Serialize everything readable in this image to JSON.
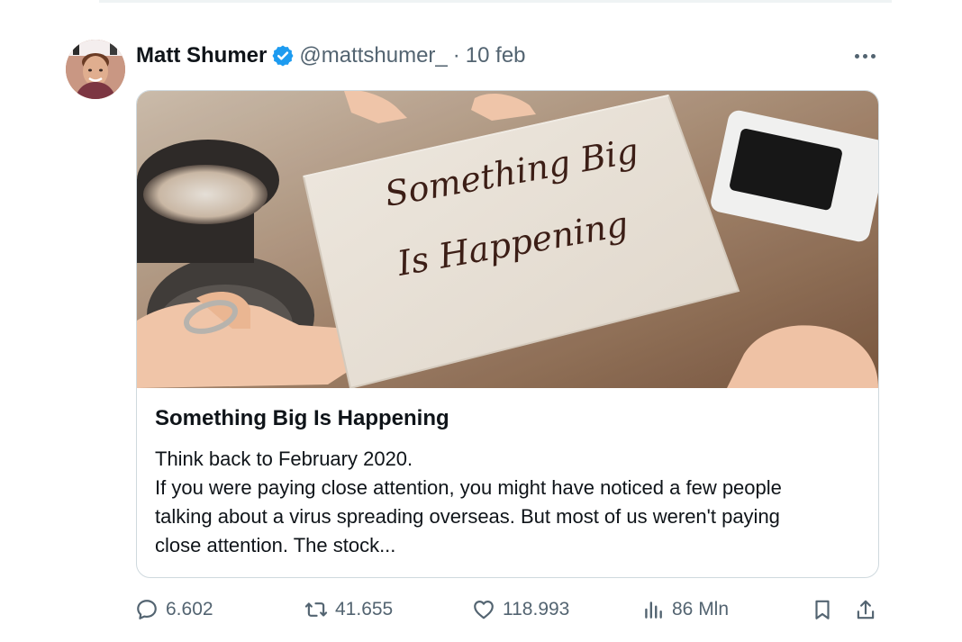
{
  "post": {
    "author_name": "Matt Shumer",
    "handle": "@mattshumer_",
    "separator": "·",
    "date": "10 feb",
    "card": {
      "image_text": [
        "Something Big",
        "Is Happening"
      ],
      "title": "Something Big Is Happening",
      "body_lines": [
        "Think back to February 2020.",
        "If you were paying close attention, you might have noticed a few people",
        "talking about a virus spreading overseas. But most of us weren't paying",
        "close attention. The stock..."
      ]
    },
    "actions": {
      "replies": "6.602",
      "reposts": "41.655",
      "likes": "118.993",
      "views": "86 Mln"
    }
  },
  "colors": {
    "verified": "#1d9bf0",
    "secondary_text": "#536471",
    "border": "#cfd9de"
  }
}
